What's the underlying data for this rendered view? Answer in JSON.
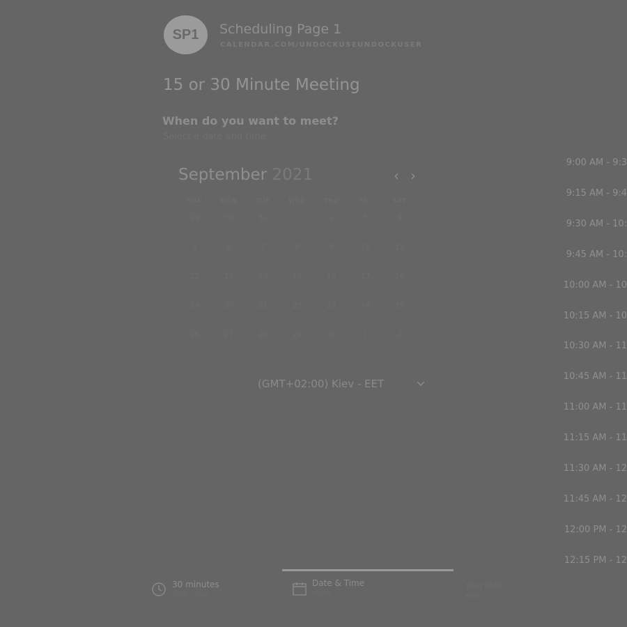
{
  "header": {
    "avatar_initials": "SP1",
    "page_name": "Scheduling Page 1",
    "page_url": "CALENDAR.COM/UNDOCKUSEUNDOCKUSER"
  },
  "meeting": {
    "title": "15 or 30 Minute Meeting",
    "question": "When do you want to meet?",
    "instruction": "Select a date and time"
  },
  "calendar": {
    "month": "September",
    "year": "2021",
    "weekdays": [
      "SUN",
      "MON",
      "TUE",
      "WED",
      "THU",
      "FRI",
      "SAT"
    ],
    "weeks": [
      [
        "29",
        "30",
        "31",
        "1",
        "2",
        "3",
        "4"
      ],
      [
        "5",
        "6",
        "7",
        "8",
        "9",
        "10",
        "11"
      ],
      [
        "12",
        "13",
        "14",
        "15",
        "16",
        "17",
        "18"
      ],
      [
        "19",
        "20",
        "21",
        "22",
        "23",
        "24",
        "25"
      ],
      [
        "26",
        "27",
        "28",
        "29",
        "30",
        "1",
        "2"
      ]
    ]
  },
  "timezone": {
    "selected": "(GMT+02:00) Kiev - EET"
  },
  "time_slots": [
    "9:00 AM - 9:3",
    "9:15 AM - 9:4",
    "9:30 AM - 10:",
    "9:45 AM - 10:",
    "10:00 AM - 10",
    "10:15 AM - 10",
    "10:30 AM - 11",
    "10:45 AM - 11",
    "11:00 AM - 11",
    "11:15 AM - 11",
    "11:30 AM - 12",
    "11:45 AM - 12",
    "12:00 PM - 12",
    "12:15 PM - 12"
  ],
  "steps": [
    {
      "title": "30 minutes",
      "subtitle": "HOW LONG"
    },
    {
      "title": "Date & Time",
      "subtitle": "WHEN"
    },
    {
      "title": "Your Info",
      "subtitle": "WHO"
    }
  ],
  "colors": {
    "overlay_background": "#656565",
    "progress_indicator": "#9a9a9a"
  }
}
